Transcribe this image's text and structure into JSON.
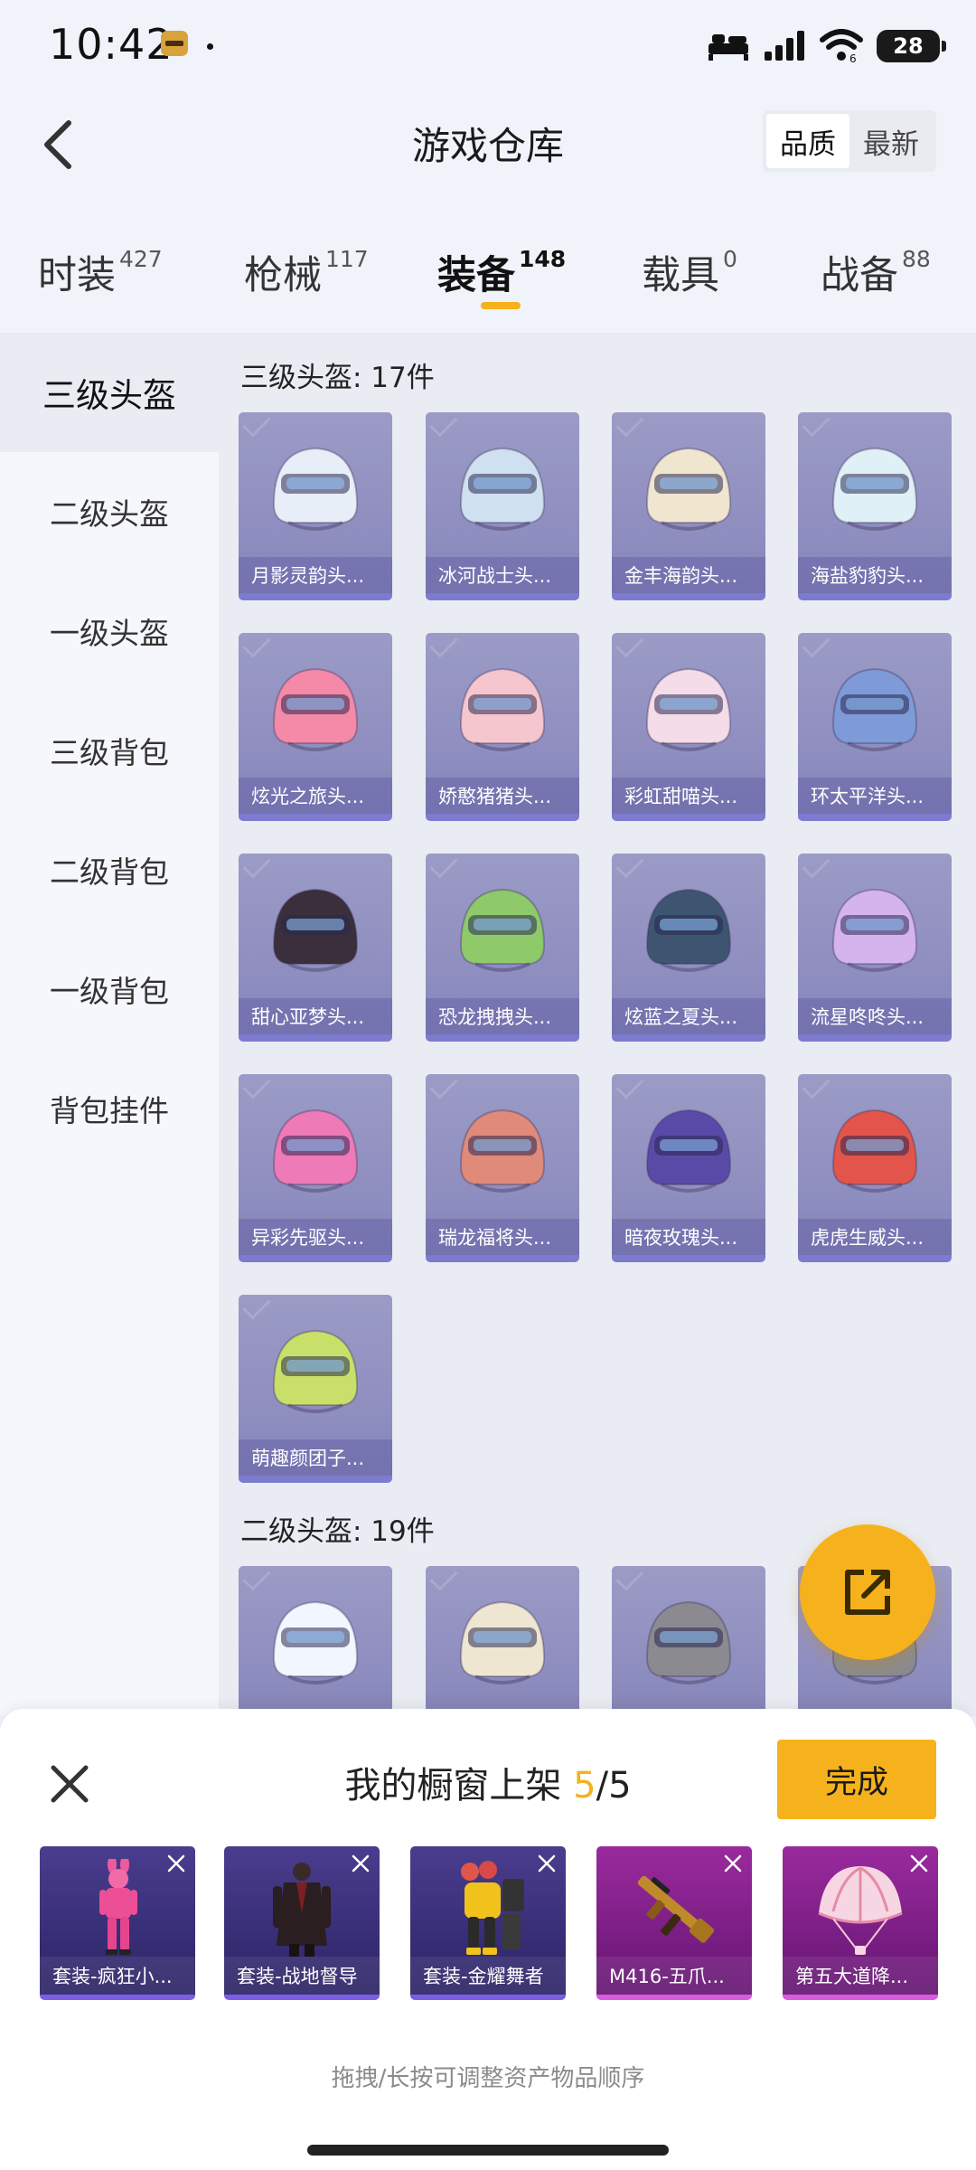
{
  "status_bar": {
    "time": "10:42",
    "battery": "28"
  },
  "header": {
    "title": "游戏仓库",
    "sort_options": [
      "品质",
      "最新"
    ]
  },
  "tabs": [
    {
      "label": "时装",
      "count": "427"
    },
    {
      "label": "枪械",
      "count": "117"
    },
    {
      "label": "装备",
      "count": "148"
    },
    {
      "label": "载具",
      "count": "0"
    },
    {
      "label": "战备",
      "count": "88"
    }
  ],
  "sidebar": {
    "items": [
      "三级头盔",
      "二级头盔",
      "一级头盔",
      "三级背包",
      "二级背包",
      "一级背包",
      "背包挂件"
    ]
  },
  "sections": [
    {
      "heading": "三级头盔: 17件",
      "items": [
        "月影灵韵头...",
        "冰河战士头...",
        "金丰海韵头...",
        "海盐豹豹头...",
        "炫光之旅头...",
        "娇憨猪猪头...",
        "彩虹甜喵头...",
        "环太平洋头...",
        "甜心亚梦头...",
        "恐龙拽拽头...",
        "炫蓝之夏头...",
        "流星咚咚头...",
        "异彩先驱头...",
        "瑞龙福将头...",
        "暗夜玫瑰头...",
        "虎虎生威头...",
        "萌趣颜团子..."
      ]
    },
    {
      "heading": "二级头盔: 19件",
      "items": [
        "",
        "",
        "",
        ""
      ]
    }
  ],
  "colors": {
    "accent": "#f6b21c",
    "card_bg": "#8e8dbf",
    "helmet_colors": [
      "#e8eef8",
      "#cfe0f0",
      "#f0e6cf",
      "#dff0f6",
      "#f48aa8",
      "#f6c6cf",
      "#f4dce8",
      "#7e9ad8",
      "#3a2f3a",
      "#8fca6a",
      "#3d5570",
      "#d5b4ee",
      "#ee7ab8",
      "#e08a7a",
      "#5a4aa8",
      "#e3554a",
      "#c8e06a",
      "#f2f6ff",
      "#eee6d0",
      "#8a8a90"
    ]
  },
  "shelf": {
    "title_prefix": "我的橱窗上架 ",
    "count": "5",
    "total": "/5",
    "done_label": "完成",
    "items": [
      {
        "label": "套装-疯狂小...",
        "style": "purple",
        "art": "pink-bunny-outfit"
      },
      {
        "label": "套装-战地督导",
        "style": "purple",
        "art": "dark-coat-outfit"
      },
      {
        "label": "套装-金耀舞者",
        "style": "purple",
        "art": "gold-dancer-outfit"
      },
      {
        "label": "M416-五爪...",
        "style": "magenta",
        "art": "gold-rifle"
      },
      {
        "label": "第五大道降...",
        "style": "magenta",
        "art": "pink-parachute"
      }
    ],
    "hint": "拖拽/长按可调整资产物品顺序"
  },
  "icons": {
    "back": "chevron-left-icon",
    "close": "close-icon",
    "share": "share-export-icon",
    "remove": "remove-x-icon"
  }
}
